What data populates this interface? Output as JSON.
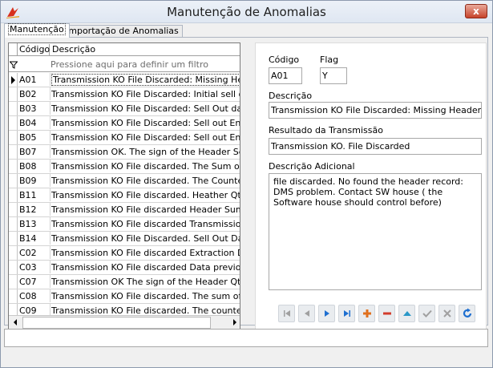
{
  "window": {
    "title": "Manutenção de Anomalias",
    "close_label": "x"
  },
  "tabs": [
    {
      "label": "Manutenção",
      "active": true
    },
    {
      "label": "Importação de Anomalias",
      "active": false
    }
  ],
  "grid": {
    "columns": [
      "Código",
      "Descrição"
    ],
    "filter_placeholder": "Pressione aqui para definir um filtro",
    "rows": [
      {
        "code": "A01",
        "desc": "Transmission KO File Discarded: Missing Header"
      },
      {
        "code": "B02",
        "desc": "Transmission KO File Discarded: Initial sell out Da"
      },
      {
        "code": "B03",
        "desc": "Transmission KO File Discarded: Sell Out date no"
      },
      {
        "code": "B04",
        "desc": "Transmission KO File Discarded: Sell out End Date"
      },
      {
        "code": "B05",
        "desc": "Transmission KO File Discarded: Sell out End date"
      },
      {
        "code": "B07",
        "desc": "Transmission OK. The sign of the Header  Sell ou"
      },
      {
        "code": "B08",
        "desc": "Transmission KO File discarded. The Sum of all th"
      },
      {
        "code": "B09",
        "desc": "Transmission KO File discarded. The Counter of t"
      },
      {
        "code": "B11",
        "desc": "Transmission KO File discarded. Heather Qty Sell"
      },
      {
        "code": "B12",
        "desc": "Transmission KO File discarded Header Sum of th"
      },
      {
        "code": "B13",
        "desc": "Transmission KO  File discarded Transmission Sell"
      },
      {
        "code": "B14",
        "desc": "Transmission KO File Discarded. Sell Out Data alr"
      },
      {
        "code": "C02",
        "desc": "Transmission KO File discarded Extraction Date is"
      },
      {
        "code": "C03",
        "desc": "Transmission KO File discarded Data previous ext"
      },
      {
        "code": "C07",
        "desc": "Transmission OK The sign of the Header Qty in S"
      },
      {
        "code": "C08",
        "desc": "Transmission KO File discarded. The sum of the c"
      },
      {
        "code": "C09",
        "desc": "Transmission KO File discarded. The counter of t"
      }
    ],
    "selected_index": 0
  },
  "details": {
    "codigo_label": "Código",
    "codigo_value": "A01",
    "flag_label": "Flag",
    "flag_value": "Y",
    "descricao_label": "Descrição",
    "descricao_value": "Transmission KO File Discarded: Missing Header",
    "resultado_label": "Resultado da Transmissão",
    "resultado_value": "Transmission KO. File Discarded",
    "adicional_label": "Descrição Adicional",
    "adicional_value": "file discarded. No found the header record: DMS problem. Contact SW house ( the Software house should control before)"
  },
  "navigator": {
    "buttons": [
      "first-icon",
      "prior-icon",
      "next-icon",
      "last-icon",
      "insert-icon",
      "delete-icon",
      "edit-icon",
      "post-icon",
      "cancel-icon",
      "refresh-icon"
    ]
  },
  "colors": {
    "nav_blue": "#1e6fd0",
    "insert_orange": "#e0701e",
    "delete_red": "#d23c2c",
    "disabled_gray": "#a0a0a0"
  }
}
